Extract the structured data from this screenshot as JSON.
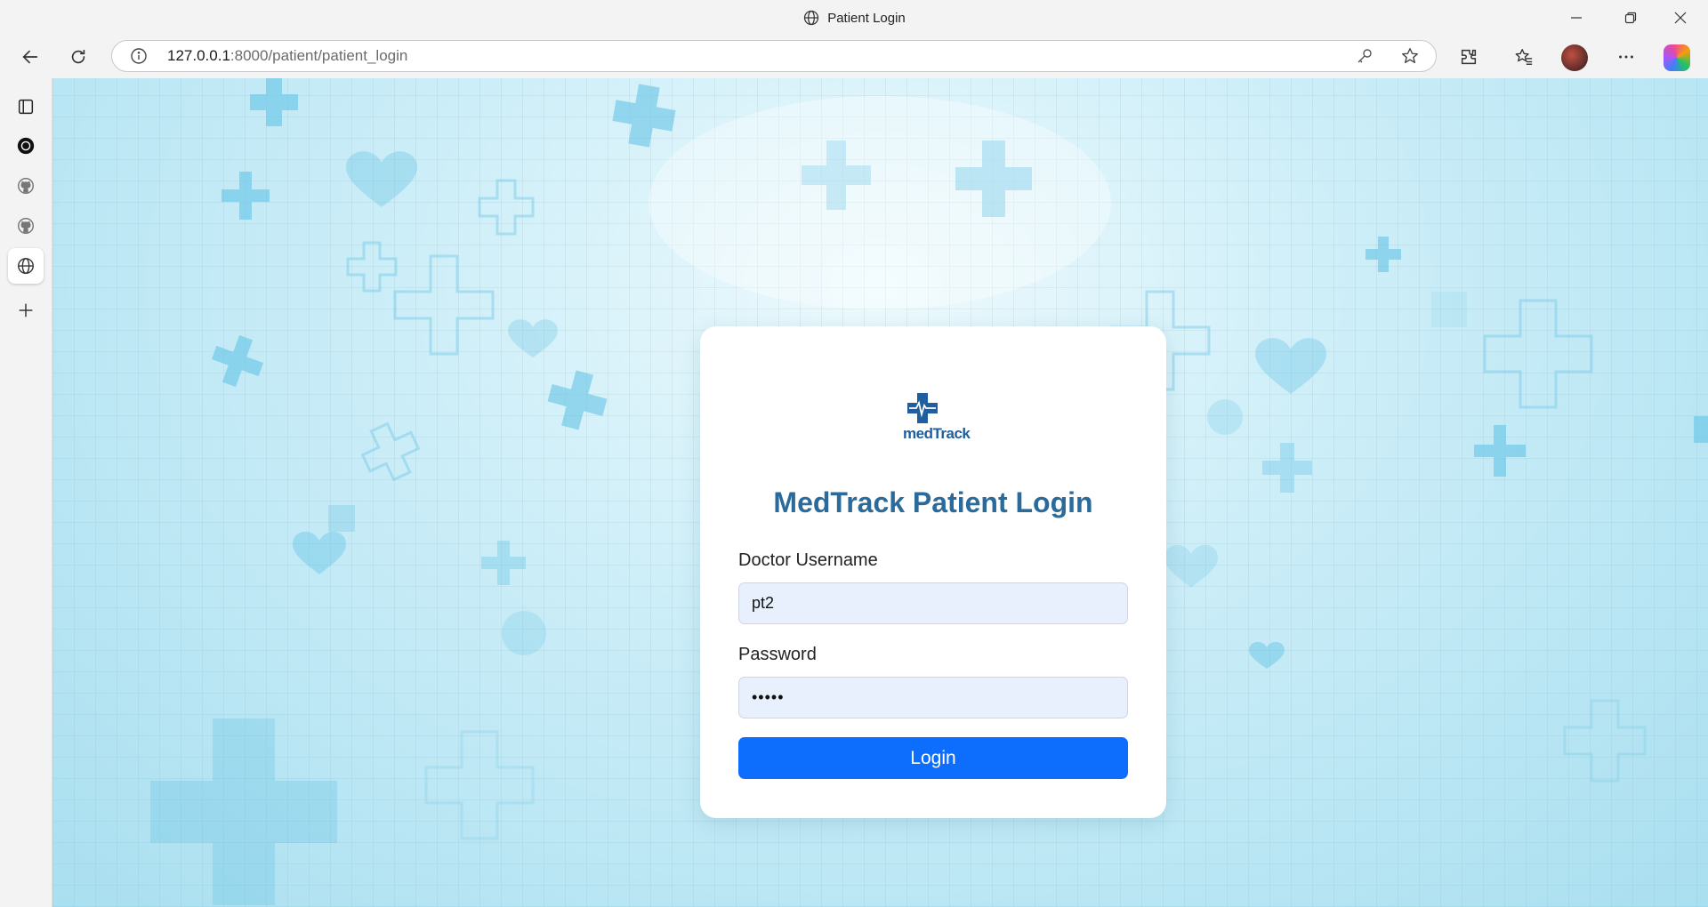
{
  "window": {
    "title": "Patient Login"
  },
  "addressbar": {
    "url_host": "127.0.0.1",
    "url_rest": ":8000/patient/patient_login"
  },
  "page": {
    "logo_text": "medTrack",
    "heading": "MedTrack Patient Login",
    "username_label": "Doctor Username",
    "username_value": "pt2",
    "password_label": "Password",
    "password_value": "•••••",
    "login_button": "Login"
  },
  "colors": {
    "primary_button": "#0d6efd",
    "heading": "#2a6b9c",
    "input_bg": "#e8f0fe"
  },
  "icons": {
    "sidebar": [
      "tabs-icon",
      "openai-icon",
      "github-icon",
      "github-icon",
      "globe-icon",
      "add-icon"
    ],
    "toolbar": [
      "back-icon",
      "refresh-icon",
      "info-icon",
      "key-icon",
      "star-icon",
      "extensions-icon",
      "favorites-icon",
      "profile-avatar",
      "more-icon",
      "copilot-icon"
    ]
  }
}
